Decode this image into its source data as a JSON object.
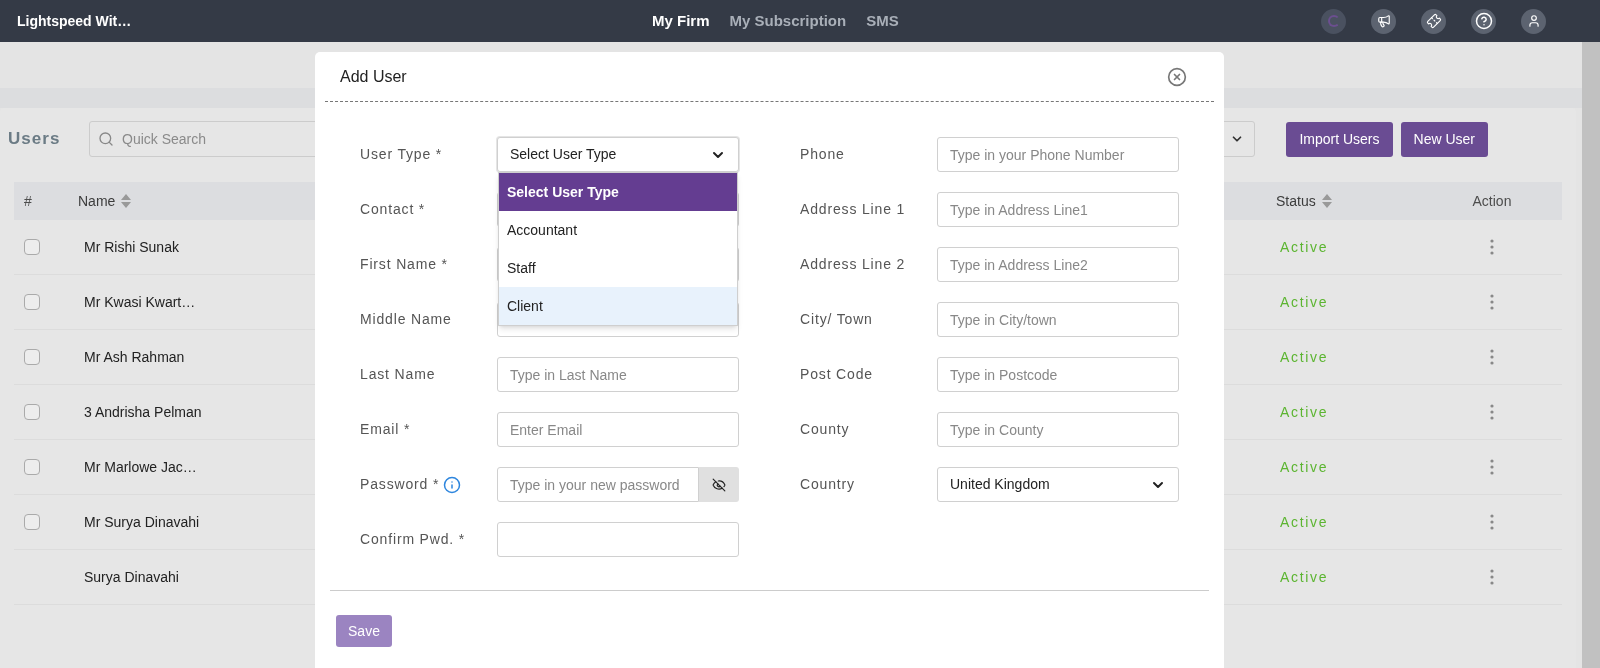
{
  "top_bar": {
    "brand": "Lightspeed Wit…",
    "nav": [
      {
        "label": "My Firm",
        "selected": true
      },
      {
        "label": "My Subscription",
        "selected": false
      },
      {
        "label": "SMS",
        "selected": false
      }
    ]
  },
  "page": {
    "title": "Users",
    "search": {
      "placeholder": "Quick Search"
    },
    "buttons": [
      "Import Users",
      "New User"
    ],
    "table": {
      "columns": [
        {
          "label": "#",
          "sortable": false
        },
        {
          "label": "Name",
          "sortable": true
        },
        {
          "label": "Status",
          "sortable": true
        },
        {
          "label": "Action",
          "sortable": false
        }
      ],
      "rows": [
        {
          "kind": "checkbox",
          "checked": false,
          "name": "Mr Rishi Sunak",
          "status": "Active"
        },
        {
          "kind": "checkbox",
          "checked": false,
          "name": "Mr Kwasi Kwart…",
          "status": "Active"
        },
        {
          "kind": "checkbox",
          "checked": false,
          "name": "Mr Ash Rahman",
          "status": "Active"
        },
        {
          "kind": "checkbox",
          "checked": false,
          "name": "3 Andrisha Pelman",
          "status": "Active"
        },
        {
          "kind": "checkbox",
          "checked": false,
          "name": "Mr Marlowe Jac…",
          "status": "Active"
        },
        {
          "kind": "checkbox",
          "checked": false,
          "name": "Mr Surya Dinavahi",
          "status": "Active"
        },
        {
          "kind": "plain",
          "name": "Surya Dinavahi",
          "status": "Active"
        }
      ]
    }
  },
  "modal": {
    "title": "Add User",
    "left_fields": [
      {
        "kind": "select",
        "label": "User Type *",
        "value": "Select User Type",
        "expanded": true,
        "options": [
          {
            "label": "Select User Type",
            "selected": true,
            "hovered": false
          },
          {
            "label": "Accountant",
            "selected": false,
            "hovered": false
          },
          {
            "label": "Staff",
            "selected": false,
            "hovered": false
          },
          {
            "label": "Client",
            "selected": false,
            "hovered": true
          }
        ]
      },
      {
        "kind": "text",
        "label": "Contact *"
      },
      {
        "kind": "text",
        "label": "First Name *"
      },
      {
        "kind": "text",
        "label": "Middle Name"
      },
      {
        "kind": "text",
        "label": "Last Name",
        "placeholder": "Type in Last Name"
      },
      {
        "kind": "text",
        "label": "Email *",
        "placeholder": "Enter Email"
      },
      {
        "kind": "password",
        "label": "Password *",
        "info": true,
        "placeholder": "Type in your new password"
      },
      {
        "kind": "text",
        "label": "Confirm Pwd. *"
      }
    ],
    "right_fields": [
      {
        "kind": "text",
        "label": "Phone",
        "placeholder": "Type in your Phone Number"
      },
      {
        "kind": "text",
        "label": "Address Line 1",
        "placeholder": "Type in Address Line1"
      },
      {
        "kind": "text",
        "label": "Address Line 2",
        "placeholder": "Type in Address Line2"
      },
      {
        "kind": "text",
        "label": "City/ Town",
        "placeholder": "Type in City/town"
      },
      {
        "kind": "text",
        "label": "Post Code",
        "placeholder": "Type in Postcode"
      },
      {
        "kind": "text",
        "label": "County",
        "placeholder": "Type in County"
      },
      {
        "kind": "select",
        "label": "Country",
        "value": "United Kingdom",
        "expanded": false
      }
    ],
    "save_button": "Save"
  }
}
